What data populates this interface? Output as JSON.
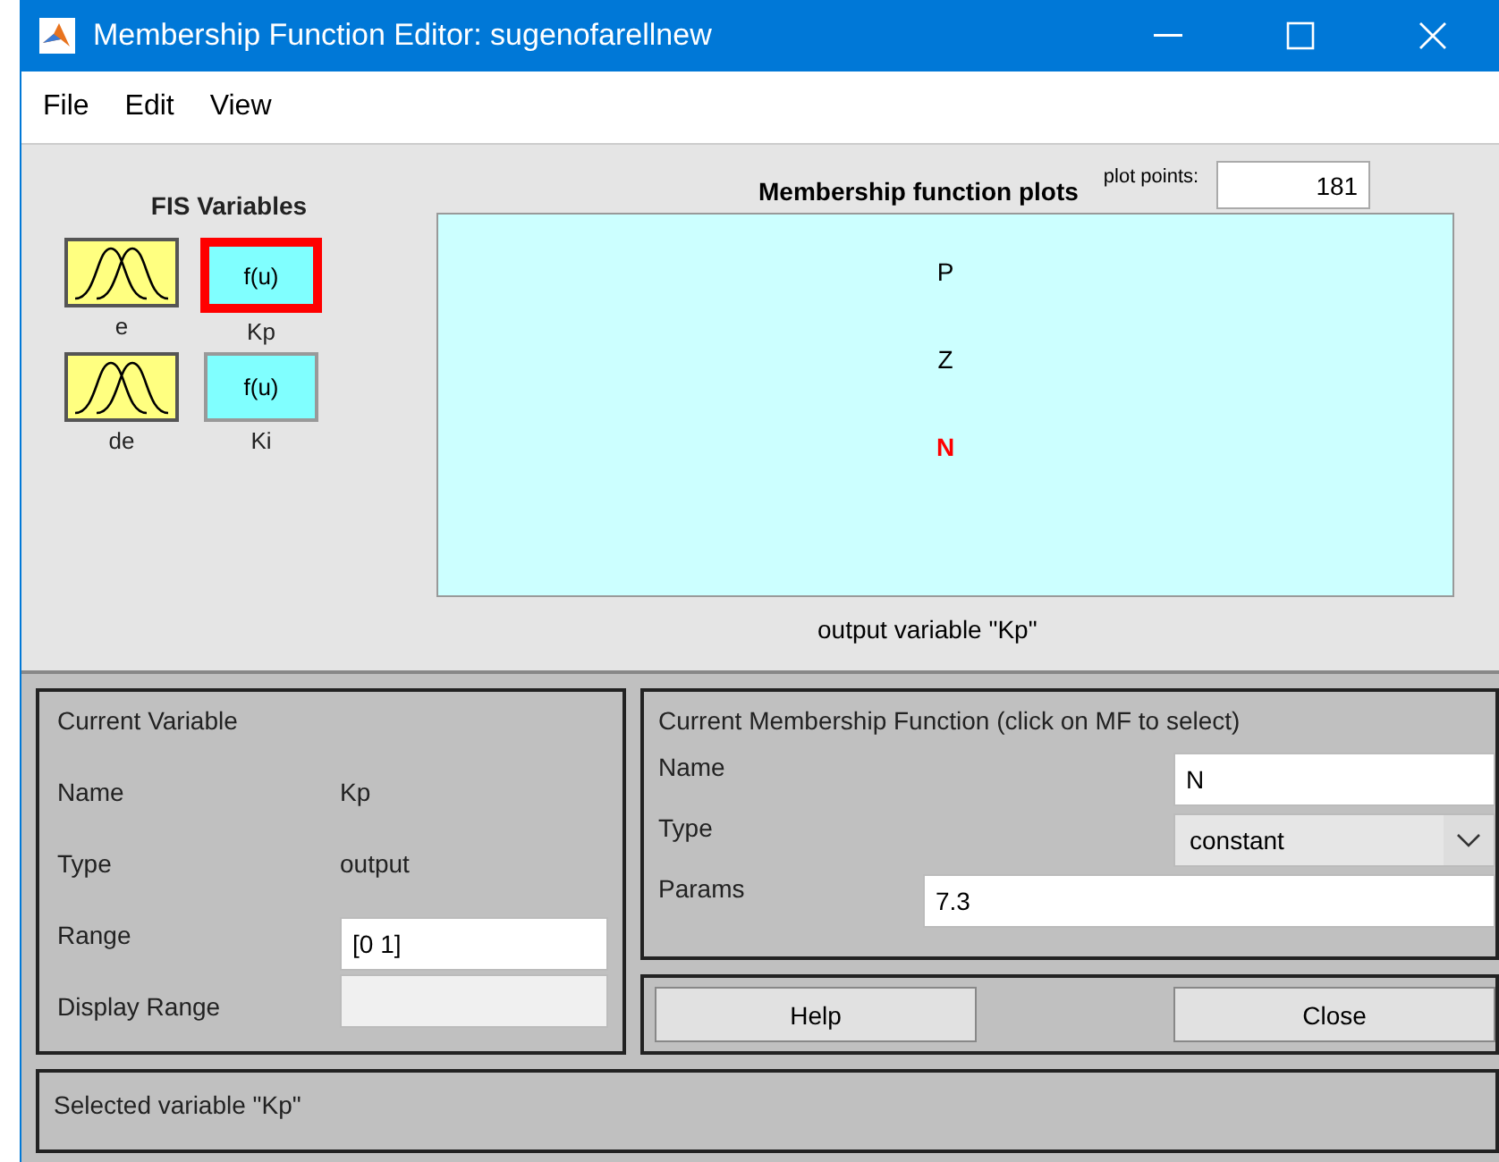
{
  "window": {
    "title": "Membership Function Editor: sugenofarellnew"
  },
  "menu": [
    "File",
    "Edit",
    "View"
  ],
  "fis_variables": {
    "title": "FIS Variables",
    "items": [
      {
        "name": "e",
        "kind": "input",
        "selected": false
      },
      {
        "name": "Kp",
        "kind": "output",
        "label": "f(u)",
        "selected": true
      },
      {
        "name": "de",
        "kind": "input",
        "selected": false
      },
      {
        "name": "Ki",
        "kind": "output",
        "label": "f(u)",
        "selected": false
      }
    ]
  },
  "plot": {
    "title": "Membership function plots",
    "plot_points_label": "plot points:",
    "plot_points": "181",
    "caption": "output variable \"Kp\"",
    "mfs": [
      {
        "name": "P",
        "selected": false
      },
      {
        "name": "Z",
        "selected": false
      },
      {
        "name": "N",
        "selected": true
      }
    ]
  },
  "current_variable": {
    "title": "Current Variable",
    "name_label": "Name",
    "name": "Kp",
    "type_label": "Type",
    "type": "output",
    "range_label": "Range",
    "range": "[0 1]",
    "display_range_label": "Display Range"
  },
  "current_mf": {
    "title": "Current Membership Function (click on MF to select)",
    "name_label": "Name",
    "name": "N",
    "type_label": "Type",
    "type": "constant",
    "params_label": "Params",
    "params": "7.3"
  },
  "buttons": [
    "Help",
    "Close"
  ],
  "status": "Selected variable \"Kp\""
}
